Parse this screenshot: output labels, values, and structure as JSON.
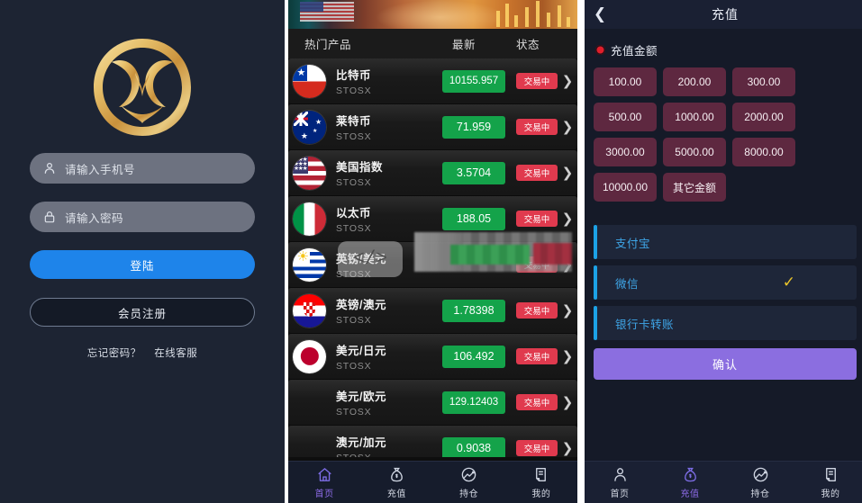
{
  "colors": {
    "login_bg": "#1d2433",
    "login_button": "#1e84ea",
    "price_green": "#14a34a",
    "status_red": "#e03a4e",
    "amount_button": "#5e2840",
    "confirm_purple": "#8b6ee0",
    "payment_bar_blue": "#1ca2e6",
    "payment_text_blue": "#3fa6e8",
    "tick_yellow": "#ebc52a",
    "tab_active": "#8e6ce8"
  },
  "login": {
    "logo_icon": "phoenix-gold-logo",
    "phone_field": {
      "placeholder": "请输入手机号",
      "value": "",
      "icon": "user-icon"
    },
    "password_field": {
      "placeholder": "请输入密码",
      "value": "",
      "icon": "lock-icon"
    },
    "login_button": "登陆",
    "register_button": "会员注册",
    "forgot_password": "忘记密码？",
    "online_service": "在线客服"
  },
  "market": {
    "banner_icon": "finance-banner-image",
    "headers": {
      "name": "热门产品",
      "last": "最新",
      "status": "状态"
    },
    "rows": [
      {
        "name": "比特币",
        "code": "STOSX",
        "price": "10155.957",
        "status": "交易中",
        "flag": "chile-flag"
      },
      {
        "name": "莱特币",
        "code": "STOSX",
        "price": "71.959",
        "status": "交易中",
        "flag": "australia-flag"
      },
      {
        "name": "美国指数",
        "code": "STOSX",
        "price": "3.5704",
        "status": "交易中",
        "flag": "usa-flag"
      },
      {
        "name": "以太币",
        "code": "STOSX",
        "price": "188.05",
        "status": "交易中",
        "flag": "italy-flag"
      },
      {
        "name": "英镑/美元",
        "code": "STOSX",
        "price": "",
        "status": "交易中",
        "flag": "uruguay-flag"
      },
      {
        "name": "英镑/澳元",
        "code": "STOSX",
        "price": "1.78398",
        "status": "交易中",
        "flag": "croatia-flag"
      },
      {
        "name": "美元/日元",
        "code": "STOSX",
        "price": "106.492",
        "status": "交易中",
        "flag": "japan-flag"
      },
      {
        "name": "美元/欧元",
        "code": "STOSX",
        "price": "129.12403",
        "status": "交易中",
        "flag": ""
      },
      {
        "name": "澳元/加元",
        "code": "STOSX",
        "price": "0.9038",
        "status": "交易中",
        "flag": ""
      }
    ],
    "watermark": "</>",
    "chevron_icon": "chevron-right-icon",
    "tabs": [
      {
        "label": "首页",
        "icon": "home-icon",
        "active": true
      },
      {
        "label": "充值",
        "icon": "moneybag-icon",
        "active": false
      },
      {
        "label": "持仓",
        "icon": "chart-circle-icon",
        "active": false
      },
      {
        "label": "我的",
        "icon": "document-icon",
        "active": false
      }
    ]
  },
  "recharge": {
    "back_icon": "chevron-left-icon",
    "title": "充值",
    "amount_label": "充值金额",
    "amount_label_icon": "red-dot-icon",
    "amounts": [
      "100.00",
      "200.00",
      "300.00",
      "500.00",
      "1000.00",
      "2000.00",
      "3000.00",
      "5000.00",
      "8000.00",
      "10000.00",
      "其它金额"
    ],
    "payment_methods": [
      {
        "name": "支付宝",
        "selected": false
      },
      {
        "name": "微信",
        "selected": true
      },
      {
        "name": "银行卡转账",
        "selected": false
      }
    ],
    "selected_icon": "checkmark-icon",
    "confirm_button": "确认",
    "tabs": [
      {
        "label": "首页",
        "icon": "person-icon",
        "active": false
      },
      {
        "label": "充值",
        "icon": "moneybag-icon",
        "active": true
      },
      {
        "label": "持仓",
        "icon": "chart-circle-icon",
        "active": false
      },
      {
        "label": "我的",
        "icon": "document-icon",
        "active": false
      }
    ]
  }
}
